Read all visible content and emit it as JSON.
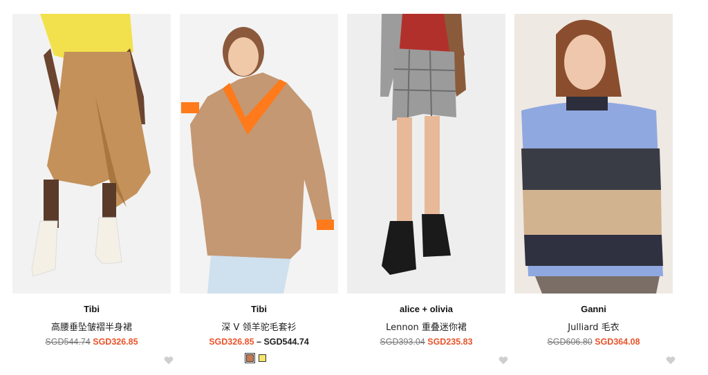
{
  "products": [
    {
      "brand": "Tibi",
      "title": "高腰垂坠皱褶半身裙",
      "price_old": "SGD544.74",
      "price_new": "SGD326.85"
    },
    {
      "brand": "Tibi",
      "title": "深 V 领羊驼毛套衫",
      "price_new": "SGD326.85",
      "price_sep": " – ",
      "price_high": "SGD544.74",
      "swatches": [
        {
          "name": "camel",
          "color": "#c9794f"
        },
        {
          "name": "yellow",
          "color": "#f4e56b"
        }
      ]
    },
    {
      "brand": "alice + olivia",
      "title": "Lennon 重叠迷你裙",
      "price_old": "SGD393.04",
      "price_new": "SGD235.83"
    },
    {
      "brand": "Ganni",
      "title": "Julliard 毛衣",
      "price_old": "SGD606.80",
      "price_new": "SGD364.08"
    }
  ],
  "colors": {
    "sale": "#e8552b",
    "strike": "#777777",
    "heart": "#cfcfcf"
  },
  "icons": {
    "favorite": "heart-icon"
  }
}
